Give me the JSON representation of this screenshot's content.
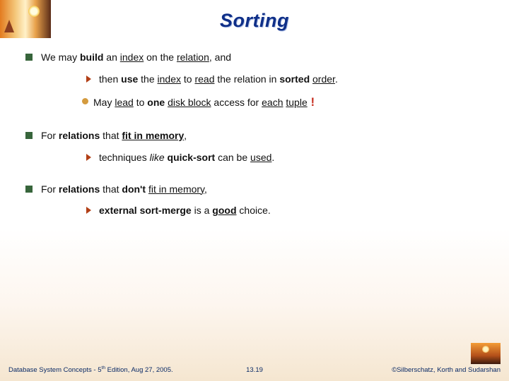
{
  "title": "Sorting",
  "bullets": {
    "b1": {
      "text_pre": "We may ",
      "bold1": "build",
      "mid1": " an ",
      "u1": "index",
      "mid2": " on the ",
      "u2": "relation",
      "post": ", and"
    },
    "b1a": {
      "pre": "then ",
      "bold1": "use",
      "mid1": " the ",
      "u1": "index",
      "mid2": " to ",
      "u2": "read",
      "mid3": " the relation in ",
      "bold2": "sorted",
      "space": " ",
      "u3": "order",
      "post": "."
    },
    "b1b": {
      "pre": "May ",
      "u1": "lead",
      "mid1": " to ",
      "bold1": "one",
      "space1": " ",
      "u2": "disk block",
      "mid2": " access for ",
      "u3": "each",
      "space2": " ",
      "u4": "tuple",
      "excl": " !"
    },
    "b2": {
      "pre": "For ",
      "bold1": "relations",
      "mid": " that ",
      "boldU": "fit in memory",
      "post": ","
    },
    "b2a": {
      "pre": "techniques ",
      "ital": "like",
      "space": " ",
      "bold1": "quick-sort",
      "mid": " can be ",
      "u1": "used",
      "post": "."
    },
    "b3": {
      "pre": "For ",
      "bold1": "relations",
      "mid1": " that ",
      "bold2": "don't",
      "space": " ",
      "u1": "fit in memory",
      "post": ","
    },
    "b3a": {
      "bold1": "external sort-merge",
      "mid": " is a ",
      "boldU": "good",
      "post": " choice."
    }
  },
  "footer": {
    "left_pre": "Database System Concepts - 5",
    "left_sup": "th",
    "left_post": " Edition, Aug 27, 2005.",
    "center": "13.19",
    "right": "©Silberschatz, Korth and Sudarshan"
  }
}
